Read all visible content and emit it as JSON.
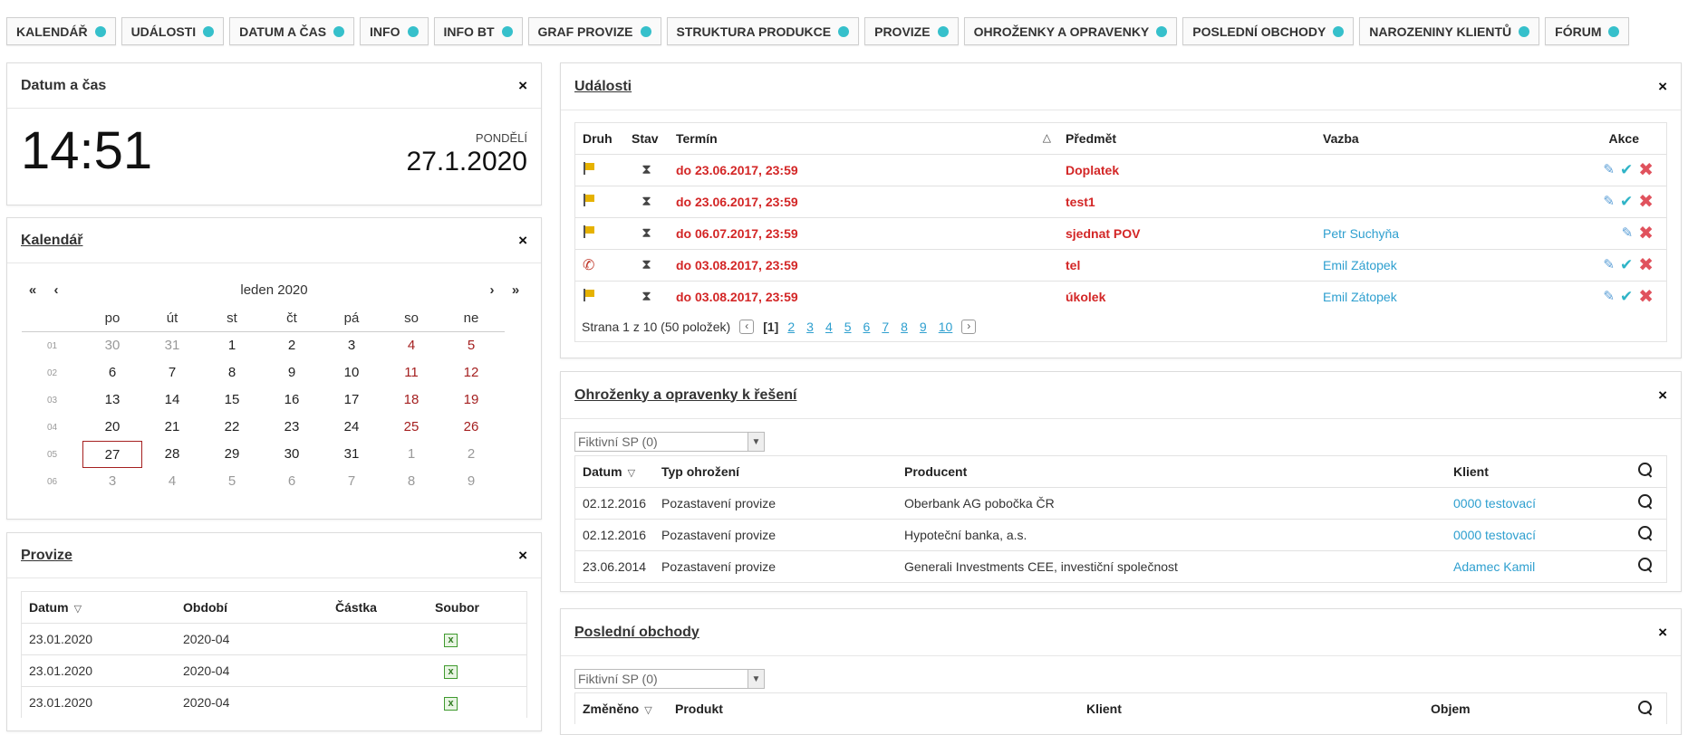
{
  "nav": [
    {
      "label": "KALENDÁŘ"
    },
    {
      "label": "UDÁLOSTI"
    },
    {
      "label": "DATUM A ČAS"
    },
    {
      "label": "INFO"
    },
    {
      "label": "INFO BT"
    },
    {
      "label": "GRAF PROVIZE"
    },
    {
      "label": "STRUKTURA PRODUKCE"
    },
    {
      "label": "PROVIZE"
    },
    {
      "label": "OHROŽENKY A OPRAVENKY"
    },
    {
      "label": "POSLEDNÍ OBCHODY"
    },
    {
      "label": "NAROZENINY KLIENTŮ"
    },
    {
      "label": "FÓRUM"
    }
  ],
  "accent_color": "#36c0cb",
  "close_symbol": "×",
  "datetime": {
    "title": "Datum a čas",
    "time": "14:51",
    "weekday": "PONDĚLÍ",
    "date": "27.1.2020"
  },
  "calendar": {
    "title": "Kalendář",
    "month": "leden 2020",
    "nav": {
      "first": "«",
      "prev": "‹",
      "next": "›",
      "last": "»"
    },
    "weekdays": [
      "po",
      "út",
      "st",
      "čt",
      "pá",
      "so",
      "ne"
    ],
    "weeks": [
      {
        "wk": "01",
        "days": [
          "30",
          "31",
          "1",
          "2",
          "3",
          "4",
          "5"
        ]
      },
      {
        "wk": "02",
        "days": [
          "6",
          "7",
          "8",
          "9",
          "10",
          "11",
          "12"
        ]
      },
      {
        "wk": "03",
        "days": [
          "13",
          "14",
          "15",
          "16",
          "17",
          "18",
          "19"
        ]
      },
      {
        "wk": "04",
        "days": [
          "20",
          "21",
          "22",
          "23",
          "24",
          "25",
          "26"
        ]
      },
      {
        "wk": "05",
        "days": [
          "27",
          "28",
          "29",
          "30",
          "31",
          "1",
          "2"
        ]
      },
      {
        "wk": "06",
        "days": [
          "3",
          "4",
          "5",
          "6",
          "7",
          "8",
          "9"
        ]
      }
    ]
  },
  "provize": {
    "title": "Provize",
    "headers": {
      "datum": "Datum",
      "obdobi": "Období",
      "castka": "Částka",
      "soubor": "Soubor"
    },
    "rows": [
      {
        "datum": "23.01.2020",
        "obdobi": "2020-04",
        "castka": ""
      },
      {
        "datum": "23.01.2020",
        "obdobi": "2020-04",
        "castka": ""
      },
      {
        "datum": "23.01.2020",
        "obdobi": "2020-04",
        "castka": ""
      }
    ]
  },
  "udalosti": {
    "title": "Události",
    "headers": {
      "druh": "Druh",
      "stav": "Stav",
      "termin": "Termín",
      "predmet": "Předmět",
      "vazba": "Vazba",
      "akce": "Akce"
    },
    "rows": [
      {
        "druh": "flag",
        "termin": "do 23.06.2017, 23:59",
        "predmet": "Doplatek",
        "vazba": "",
        "ok": true
      },
      {
        "druh": "flag",
        "termin": "do 23.06.2017, 23:59",
        "predmet": "test1",
        "vazba": "",
        "ok": true
      },
      {
        "druh": "flag",
        "termin": "do 06.07.2017, 23:59",
        "predmet": "sjednat POV",
        "vazba": "Petr Suchyňa",
        "ok": false
      },
      {
        "druh": "phone",
        "termin": "do 03.08.2017, 23:59",
        "predmet": "tel",
        "vazba": "Emil Zátopek",
        "ok": true
      },
      {
        "druh": "flag",
        "termin": "do 03.08.2017, 23:59",
        "predmet": "úkolek",
        "vazba": "Emil Zátopek",
        "ok": true
      }
    ],
    "pager": {
      "info": "Strana 1 z 10 (50 položek)",
      "current": "[1]",
      "pages": [
        "2",
        "3",
        "4",
        "5",
        "6",
        "7",
        "8",
        "9",
        "10"
      ]
    }
  },
  "ohrozenky": {
    "title": "Ohroženky a opravenky k řešení",
    "select": "Fiktivní SP (0)",
    "headers": {
      "datum": "Datum",
      "typ": "Typ ohrožení",
      "producent": "Producent",
      "klient": "Klient"
    },
    "rows": [
      {
        "datum": "02.12.2016",
        "typ": "Pozastavení provize",
        "producent": "Oberbank AG pobočka ČR",
        "klient": "0000 testovací"
      },
      {
        "datum": "02.12.2016",
        "typ": "Pozastavení provize",
        "producent": "Hypoteční banka, a.s.",
        "klient": "0000 testovací"
      },
      {
        "datum": "23.06.2014",
        "typ": "Pozastavení provize",
        "producent": "Generali Investments CEE, investiční společnost",
        "klient": "Adamec Kamil"
      }
    ]
  },
  "obchody": {
    "title": "Poslední obchody",
    "select": "Fiktivní SP (0)",
    "headers": {
      "zmeneno": "Změněno",
      "produkt": "Produkt",
      "klient": "Klient",
      "objem": "Objem"
    }
  }
}
